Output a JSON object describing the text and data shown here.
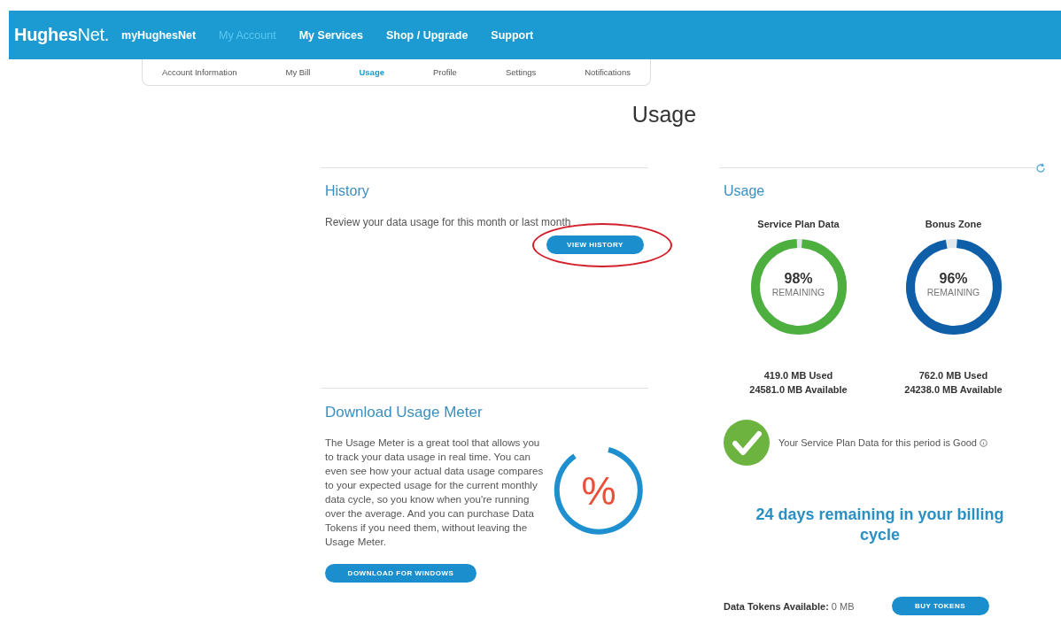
{
  "header": {
    "logo": "**Hughes**Net.",
    "nav": [
      {
        "label": "myHughesNet",
        "selected": false
      },
      {
        "label": "My Account",
        "selected": true
      },
      {
        "label": "My Services",
        "selected": false
      },
      {
        "label": "Shop / Upgrade",
        "selected": false
      },
      {
        "label": "Support",
        "selected": false
      }
    ]
  },
  "subnav": [
    {
      "label": "Account Information",
      "selected": false
    },
    {
      "label": "My Bill",
      "selected": false
    },
    {
      "label": "Usage",
      "selected": true
    },
    {
      "label": "Profile",
      "selected": false
    },
    {
      "label": "Settings",
      "selected": false
    },
    {
      "label": "Notifications",
      "selected": false
    }
  ],
  "page_title": "Usage",
  "history": {
    "title": "History",
    "text": "Review your data usage for this month or last month",
    "button": {
      "label": "VIEW HISTORY",
      "highlighted": true
    }
  },
  "download": {
    "title": "Download Usage Meter",
    "text": "The Usage Meter is a great tool that allows you to track your data usage in real time. You can even see how your actual data usage compares to your expected usage for the current monthly data cycle, so you know when you're running over the average. And you can purchase Data Tokens if you need them, without leaving the Usage Meter.",
    "icon_symbol": "%",
    "button": "DOWNLOAD FOR WINDOWS"
  },
  "usage": {
    "title": "Usage",
    "gauges": [
      {
        "title": "Service Plan Data",
        "level": 0.98,
        "percent": "98%",
        "caption": "REMAINING",
        "color": "#4caf3e",
        "used": "419.0 MB Used",
        "available": "24581.0 MB Available"
      },
      {
        "title": "Bonus Zone",
        "level": 0.96,
        "percent": "96%",
        "caption": "REMAINING",
        "color": "#0f5fa8",
        "used": "762.0 MB Used",
        "available": "24238.0 MB Available"
      }
    ],
    "status": {
      "good": true,
      "text": "Your Service Plan Data for this period is Good"
    },
    "days_remaining": "24 days remaining in your billing cycle",
    "tokens": {
      "label": "Data Tokens Available:",
      "value": "0 MB",
      "button": "BUY TOKENS"
    }
  }
}
